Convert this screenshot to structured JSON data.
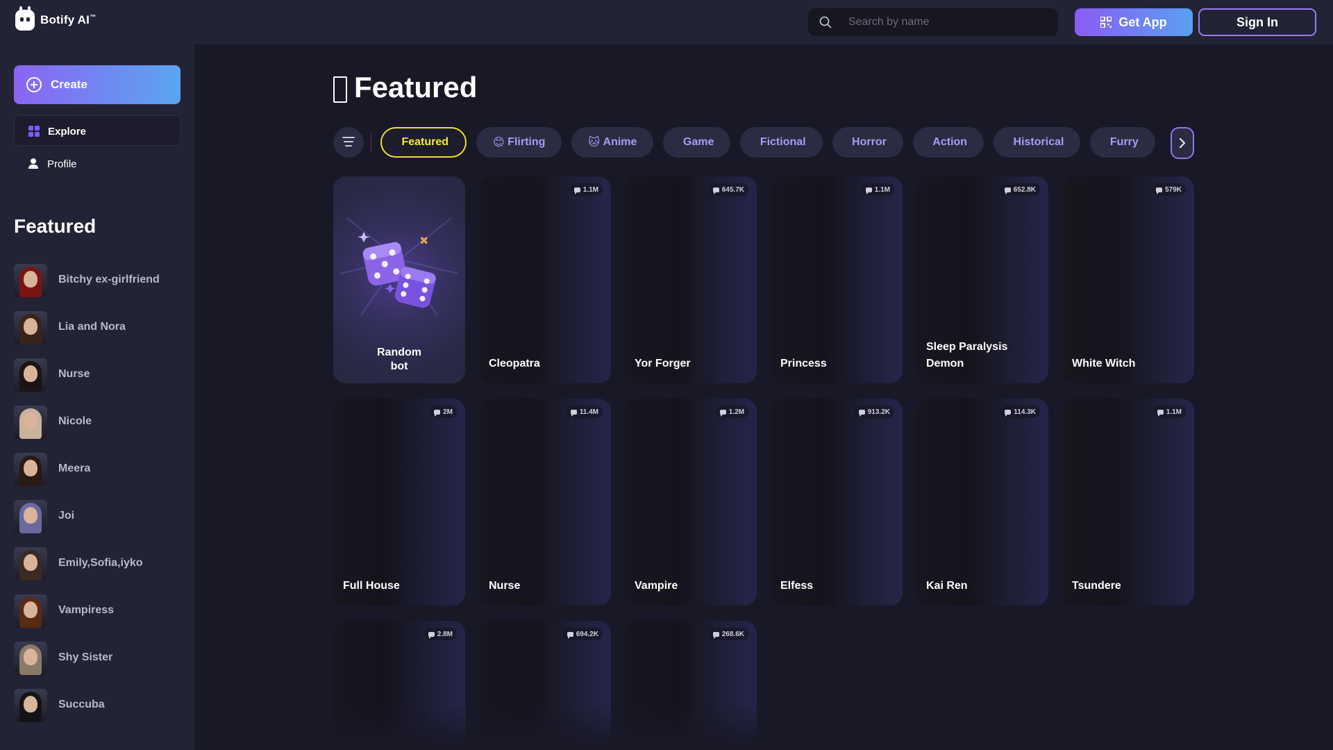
{
  "header": {
    "brand": "Botify AI",
    "brand_mark": "™",
    "search_placeholder": "Search by name",
    "get_app_label": "Get App",
    "sign_in_label": "Sign In"
  },
  "sidebar": {
    "create_label": "Create",
    "nav": [
      {
        "label": "Explore",
        "icon": "grid-icon"
      },
      {
        "label": "Profile",
        "icon": "person-icon"
      }
    ],
    "featured_title": "Featured",
    "featured_items": [
      {
        "name": "Bitchy ex-girlfriend",
        "hair": "#7a1414"
      },
      {
        "name": "Lia and Nora",
        "hair": "#3a2418"
      },
      {
        "name": "Nurse",
        "hair": "#1c1414"
      },
      {
        "name": "Nicole",
        "hair": "#c9b39a"
      },
      {
        "name": "Meera",
        "hair": "#2a1a12"
      },
      {
        "name": "Joi",
        "hair": "#6a6aa0"
      },
      {
        "name": "Emily,Sofia,iyko",
        "hair": "#3a2a22"
      },
      {
        "name": "Vampiress",
        "hair": "#5a2a12"
      },
      {
        "name": "Shy Sister",
        "hair": "#8a7a6a"
      },
      {
        "name": "Succuba",
        "hair": "#141418"
      }
    ]
  },
  "main": {
    "title": "Featured",
    "chips": [
      {
        "label": "Featured",
        "prefix": "",
        "active": true
      },
      {
        "label": "Flirting",
        "prefix": "😊",
        "active": false
      },
      {
        "label": "Anime",
        "prefix": "🐱",
        "active": false
      },
      {
        "label": "Game",
        "prefix": "",
        "active": false
      },
      {
        "label": "Fictional",
        "prefix": "",
        "active": false
      },
      {
        "label": "Horror",
        "prefix": "",
        "active": false
      },
      {
        "label": "Action",
        "prefix": "",
        "active": false
      },
      {
        "label": "Historical",
        "prefix": "",
        "active": false
      },
      {
        "label": "Furry",
        "prefix": "",
        "active": false
      }
    ],
    "random_card": {
      "line1": "Random",
      "line2": "bot"
    },
    "cards": [
      {
        "name": "Cleopatra",
        "count": "1.1M"
      },
      {
        "name": "Yor Forger",
        "count": "645.7K"
      },
      {
        "name": "Princess",
        "count": "1.1M"
      },
      {
        "name": "Sleep Paralysis Demon",
        "count": "652.8K"
      },
      {
        "name": "White Witch",
        "count": "579K"
      },
      {
        "name": "Full House",
        "count": "2M"
      },
      {
        "name": "Nurse",
        "count": "11.4M"
      },
      {
        "name": "Vampire",
        "count": "1.2M"
      },
      {
        "name": "Elfess",
        "count": "913.2K"
      },
      {
        "name": "Kai Ren",
        "count": "114.3K"
      },
      {
        "name": "Tsundere",
        "count": "1.1M"
      },
      {
        "name": "",
        "count": "2.8M"
      },
      {
        "name": "",
        "count": "694.2K"
      },
      {
        "name": "",
        "count": "268.6K"
      }
    ]
  },
  "colors": {
    "accent_purple": "#8b64f3",
    "accent_blue": "#5aa6f0",
    "active_chip": "#f2df26",
    "background": "#181827",
    "sidebar": "#232336"
  }
}
